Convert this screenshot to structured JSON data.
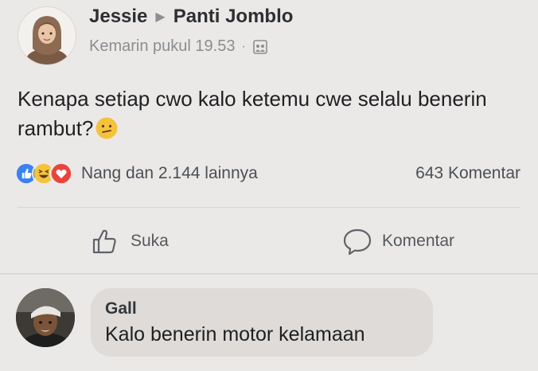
{
  "post": {
    "author": "Jessie",
    "group": "Panti Jomblo",
    "timestamp": "Kemarin pukul 19.53",
    "separator": "·",
    "privacy_icon": "public-group-icon",
    "text": "Kenapa setiap cwo kalo ketemu cwe selalu benerin rambut?",
    "text_emoji": "confused-face-emoji"
  },
  "reactions": {
    "icons": [
      "like-reaction-icon",
      "haha-reaction-icon",
      "love-reaction-icon"
    ],
    "summary": "Nang dan 2.144 lainnya",
    "comments_count": "643 Komentar"
  },
  "actions": {
    "like_label": "Suka",
    "comment_label": "Komentar"
  },
  "comment": {
    "author": "Gall",
    "text": "Kalo benerin motor kelamaan"
  },
  "colors": {
    "background": "#ebe9e7",
    "like_blue": "#3b82f0",
    "love_red": "#e8443e",
    "haha_yellow": "#f5c33b"
  }
}
